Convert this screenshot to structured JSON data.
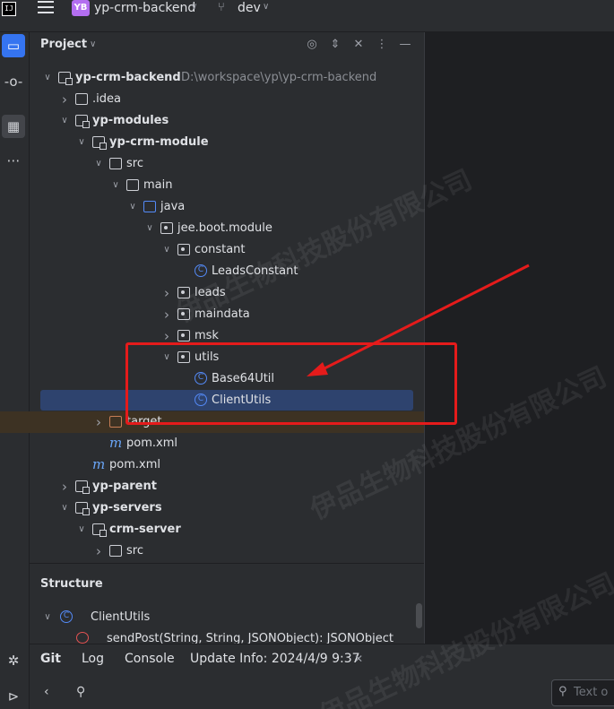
{
  "titlebar": {
    "logo_text": "IJ",
    "project_badge": "YB",
    "project_name": "yp-crm-backend",
    "branch_name": "dev"
  },
  "project_panel": {
    "title": "Project",
    "tree": [
      {
        "label": "yp-crm-backend",
        "hint": "D:\\workspace\\yp\\yp-crm-backend",
        "arrow": "open",
        "icon": "module-folder",
        "bold": true
      },
      {
        "label": ".idea",
        "arrow": "closed",
        "icon": "folder"
      },
      {
        "label": "yp-modules",
        "arrow": "open",
        "icon": "module-folder",
        "bold": true
      },
      {
        "label": "yp-crm-module",
        "arrow": "open",
        "icon": "module-folder",
        "bold": true
      },
      {
        "label": "src",
        "arrow": "open",
        "icon": "folder"
      },
      {
        "label": "main",
        "arrow": "open",
        "icon": "folder"
      },
      {
        "label": "java",
        "arrow": "open",
        "icon": "source-folder"
      },
      {
        "label": "jee.boot.module",
        "arrow": "open",
        "icon": "package"
      },
      {
        "label": "constant",
        "arrow": "open",
        "icon": "package"
      },
      {
        "label": "LeadsConstant",
        "arrow": "none",
        "icon": "class"
      },
      {
        "label": "leads",
        "arrow": "closed",
        "icon": "package"
      },
      {
        "label": "maindata",
        "arrow": "closed",
        "icon": "package"
      },
      {
        "label": "msk",
        "arrow": "closed",
        "icon": "package"
      },
      {
        "label": "utils",
        "arrow": "open",
        "icon": "package"
      },
      {
        "label": "Base64Util",
        "arrow": "none",
        "icon": "class"
      },
      {
        "label": "ClientUtils",
        "arrow": "none",
        "icon": "class",
        "selected": true
      },
      {
        "label": "target",
        "arrow": "closed",
        "icon": "excluded-folder",
        "excluded": true
      },
      {
        "label": "pom.xml",
        "arrow": "none",
        "icon": "maven"
      },
      {
        "label": "pom.xml",
        "arrow": "none",
        "icon": "maven"
      },
      {
        "label": "yp-parent",
        "arrow": "closed",
        "icon": "module-folder",
        "bold": true
      },
      {
        "label": "yp-servers",
        "arrow": "open",
        "icon": "module-folder",
        "bold": true
      },
      {
        "label": "crm-server",
        "arrow": "open",
        "icon": "module-folder",
        "bold": true
      },
      {
        "label": "src",
        "arrow": "closed",
        "icon": "folder"
      }
    ]
  },
  "structure_panel": {
    "title": "Structure",
    "root_item": "ClientUtils",
    "method_item": "sendPost(String, String, JSONObject): JSONObject"
  },
  "bottom_tabs": {
    "git": "Git",
    "log": "Log",
    "console": "Console",
    "update_info": "Update Info: 2024/4/9 9:37"
  },
  "bottom_search": {
    "placeholder": "Text o"
  },
  "watermark": "伊品生物科技股份有限公司",
  "colors": {
    "accent": "#3574f0",
    "selection": "#2e436e",
    "annotation_red": "#e51b1b",
    "excluded_bg": "#3d3223"
  }
}
